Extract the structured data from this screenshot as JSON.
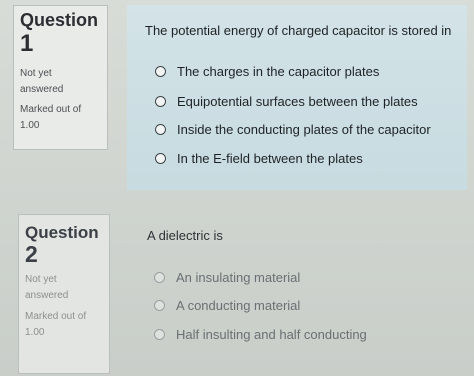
{
  "q1": {
    "label": "Question",
    "number": "1",
    "status": "Not yet answered",
    "marked": "Marked out of 1.00",
    "prompt": "The potential energy of charged capacitor is stored in",
    "options": [
      "The charges in the capacitor plates",
      "Equipotential surfaces between the plates",
      "Inside the conducting plates of the capacitor",
      "In the E-field between the plates"
    ]
  },
  "q2": {
    "label": "Question",
    "number": "2",
    "status": "Not yet answered",
    "marked": "Marked out of 1.00",
    "prompt": "A dielectric is",
    "options": [
      "An insulating material",
      "A conducting material",
      "Half insulting and half conducting"
    ]
  }
}
